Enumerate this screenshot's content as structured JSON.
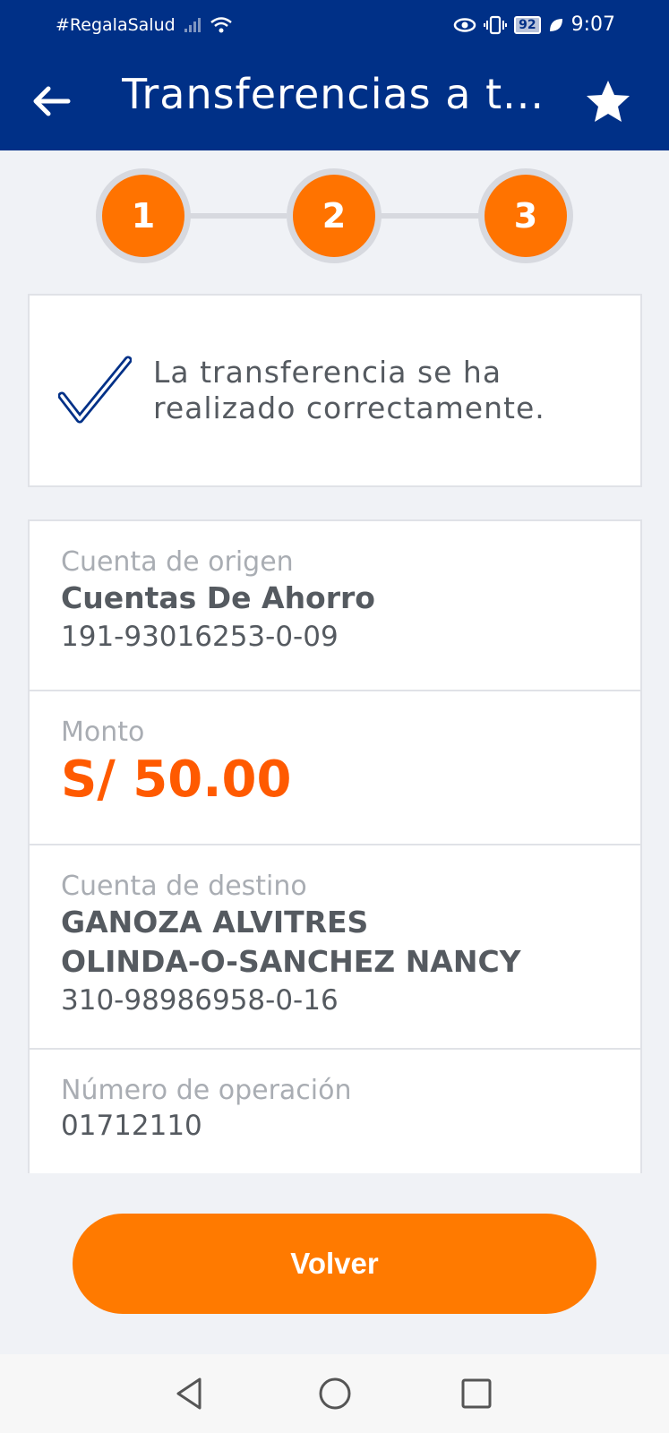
{
  "status_bar": {
    "carrier": "#RegalaSalud",
    "battery": "92",
    "time": "9:07"
  },
  "app_bar": {
    "title": "Transferencias a t...",
    "back_icon": "arrow-left-icon",
    "favorite_icon": "star-icon"
  },
  "stepper": {
    "steps": [
      "1",
      "2",
      "3"
    ],
    "current_step": 3,
    "active_color": "#ff7300"
  },
  "success": {
    "message": "La transferencia se ha realizado correctamente.",
    "icon": "check-icon"
  },
  "details": {
    "origin": {
      "label": "Cuenta de origen",
      "account_type": "Cuentas De Ahorro",
      "account_number": "191-93016253-0-09"
    },
    "amount": {
      "label": "Monto",
      "value": "S/ 50.00",
      "color": "#ff5a00"
    },
    "destination": {
      "label": "Cuenta de destino",
      "name_line1": "GANOZA ALVITRES",
      "name_line2": "OLINDA-O-SANCHEZ NANCY",
      "account_number": "310-98986958-0-16"
    },
    "operation": {
      "label": "Número de operación",
      "number": "01712110"
    }
  },
  "actions": {
    "back_button": "Volver"
  },
  "colors": {
    "header_bg": "#003087",
    "accent": "#ff7a00"
  }
}
